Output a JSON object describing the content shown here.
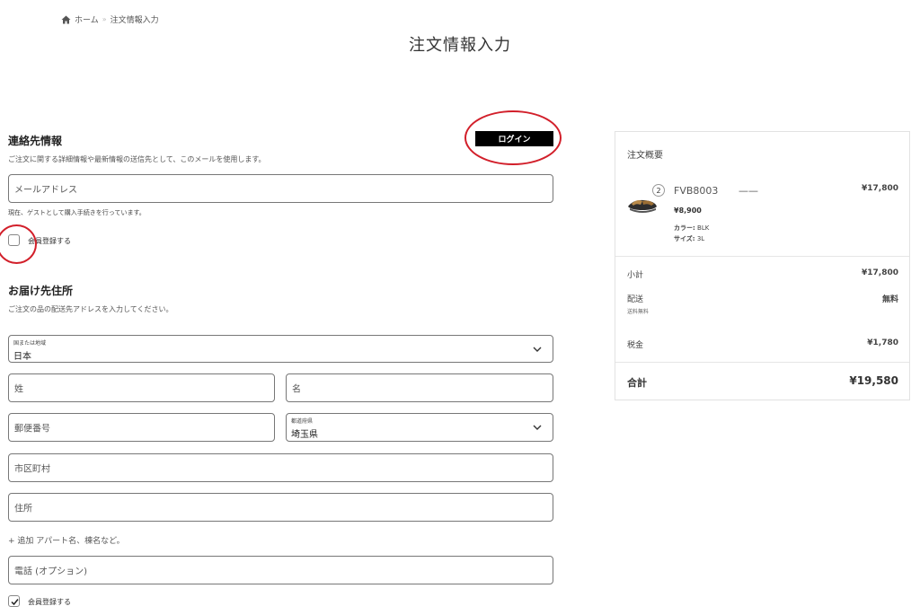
{
  "breadcrumb": {
    "home": "ホーム",
    "current": "注文情報入力"
  },
  "page_title": "注文情報入力",
  "contact": {
    "title": "連絡先情報",
    "description": "ご注文に関する詳細情報や最新情報の送信先として、このメールを使用します。",
    "login_label": "ログイン",
    "email_placeholder": "メールアドレス",
    "guest_note": "現在、ゲストとして購入手続きを行っています。",
    "register_label": "会員登録する",
    "register_checked": false
  },
  "shipping": {
    "title": "お届け先住所",
    "description": "ご注文の品の配送先アドレスを入力してください。",
    "country_label": "国または地域",
    "country_value": "日本",
    "last_name_placeholder": "姓",
    "first_name_placeholder": "名",
    "postal_placeholder": "郵便番号",
    "prefecture_label": "都道府県",
    "prefecture_value": "埼玉県",
    "city_placeholder": "市区町村",
    "address_placeholder": "住所",
    "add_link": "+ 追加 アパート名、棟名など。",
    "phone_placeholder": "電話 (オプション)",
    "register_label": "会員登録する",
    "register_checked": true
  },
  "summary": {
    "title": "注文概要",
    "product": {
      "name": "FVB8003",
      "dash": "——",
      "quantity": "2",
      "unit_price": "¥8,900",
      "line_total": "¥17,800",
      "color_label": "カラー:",
      "color_value": "BLK",
      "size_label": "サイズ:",
      "size_value": "3L"
    },
    "subtotal_label": "小計",
    "subtotal_value": "¥17,800",
    "shipping_label": "配送",
    "shipping_sub": "送料無料",
    "shipping_value": "無料",
    "tax_label": "税金",
    "tax_value": "¥1,780",
    "total_label": "合計",
    "total_value": "¥19,580"
  },
  "colors": {
    "annotation_red": "#d21f2a",
    "button_black": "#000000"
  },
  "icons": [
    "home-icon",
    "chevron-down-icon",
    "check-icon",
    "sandal-image"
  ]
}
